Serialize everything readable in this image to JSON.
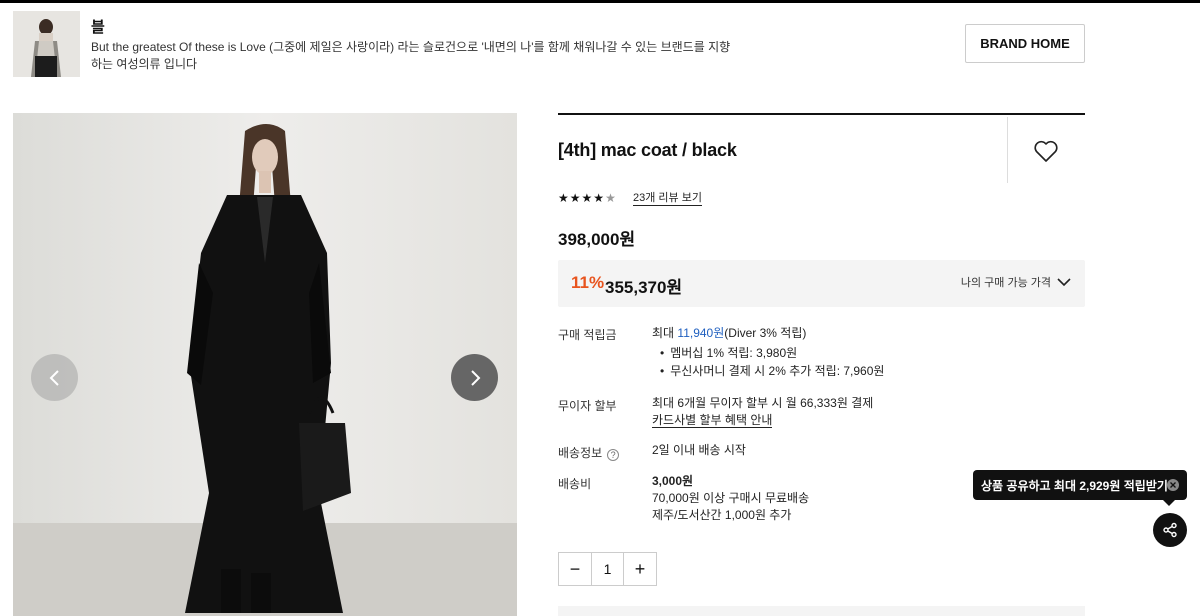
{
  "brand": {
    "name": "블",
    "description": "But the greatest Of these is Love (그중에 제일은 사랑이라) 라는 슬로건으로 '내면의 나'를 함께 채워나갈 수 있는 브랜드를 지향하는 여성의류 입니다",
    "home_button": "BRAND HOME"
  },
  "product": {
    "title": "[4th] mac coat / black",
    "rating": 4.5,
    "review_link": "23개 리뷰 보기",
    "price": "398,000원",
    "sale_percent": "11%",
    "sale_price": "355,370원",
    "my_price_label": "나의 구매 가능 가격"
  },
  "details": {
    "points_label": "구매 적립금",
    "points_prefix": "최대 ",
    "points_amount": "11,940원",
    "points_suffix": "(Diver 3% 적립)",
    "points_bullets": [
      "멤버십 1% 적립: 3,980원",
      "무신사머니 결제 시 2% 추가 적립: 7,960원"
    ],
    "installment_label": "무이자 할부",
    "installment_text": "최대 6개월 무이자 할부 시 월 66,333원 결제",
    "installment_link": "카드사별 할부 혜택 안내",
    "shipping_info_label": "배송정보",
    "shipping_info_text": "2일 이내 배송 시작",
    "shipping_fee_label": "배송비",
    "shipping_fee": "3,000원",
    "shipping_free": "70,000원 이상 구매시 무료배송",
    "shipping_extra": "제주/도서산간 1,000원 추가"
  },
  "quantity": {
    "value": "1",
    "minus": "−",
    "plus": "+"
  },
  "share": {
    "tooltip": "상품 공유하고 최대 2,929원 적립받기"
  },
  "colors": {
    "accent_orange": "#e8541e",
    "accent_blue": "#1f5fbf"
  },
  "icons": [
    "heart-icon",
    "chevron-left-icon",
    "chevron-right-icon",
    "chevron-down-icon",
    "question-icon",
    "close-icon",
    "share-icon",
    "star-icon"
  ]
}
